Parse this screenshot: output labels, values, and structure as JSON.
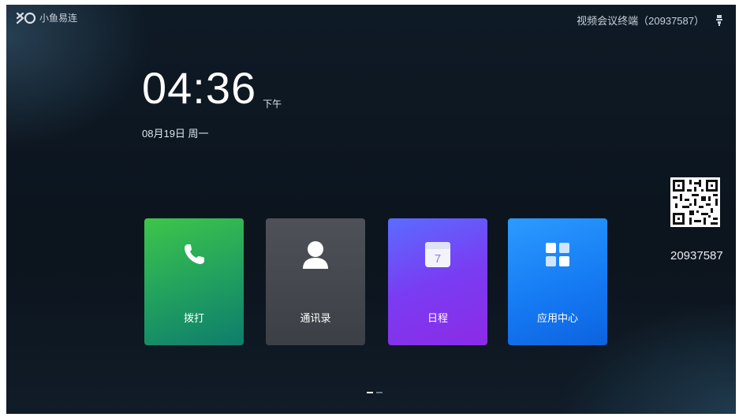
{
  "header": {
    "logo_text": "小鱼易连",
    "device_label": "视频会议终端（20937587）"
  },
  "clock": {
    "time": "04:36",
    "ampm": "下午",
    "date": "08月19日 周一"
  },
  "tiles": [
    {
      "label": "拨打",
      "icon": "phone-icon"
    },
    {
      "label": "通讯录",
      "icon": "person-icon"
    },
    {
      "label": "日程",
      "icon": "calendar-icon",
      "calendar_day": "7"
    },
    {
      "label": "应用中心",
      "icon": "app-grid-icon"
    }
  ],
  "qr": {
    "number": "20937587"
  },
  "pager": {
    "pages": 2,
    "current": 1
  },
  "colors": {
    "dial": "#2fb352",
    "contacts": "#46494f",
    "schedule": "#7a3cf2",
    "apps": "#1478f2"
  }
}
